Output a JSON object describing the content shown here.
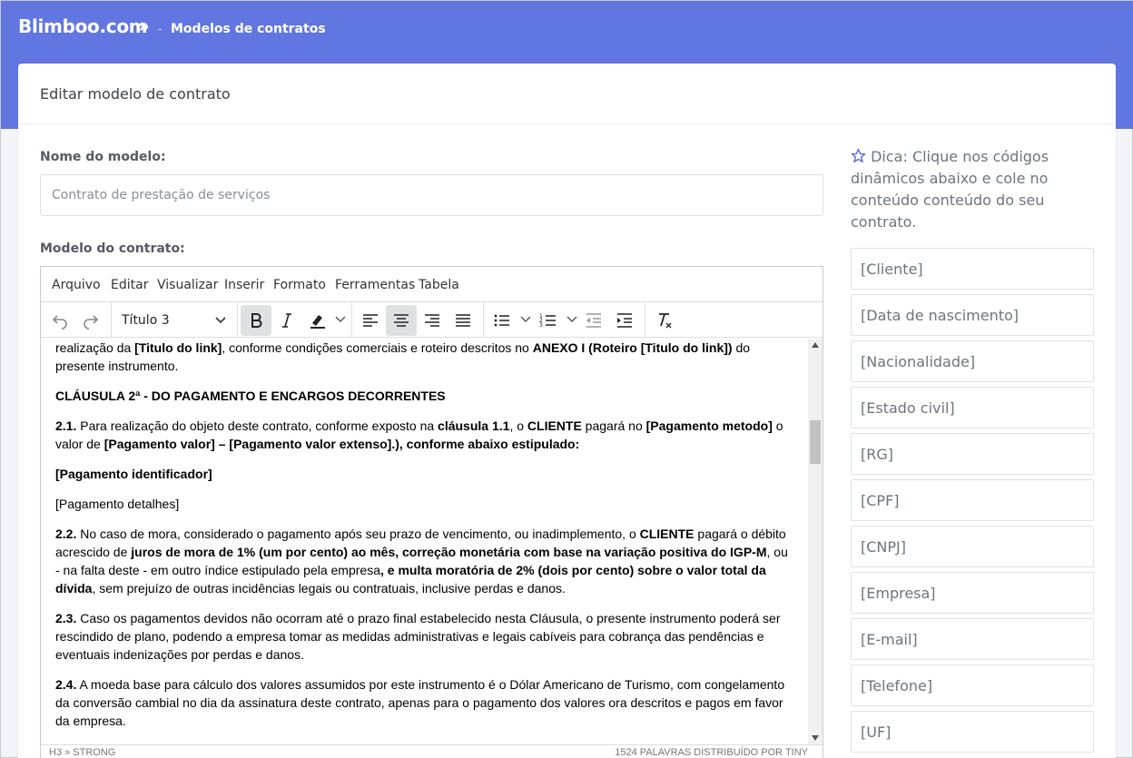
{
  "header": {
    "brand": "Blimboo.com",
    "brand_separator": "»",
    "crumb_dash": "-",
    "crumb": "Modelos de contratos"
  },
  "card": {
    "title": "Editar modelo de contrato"
  },
  "form": {
    "name_label": "Nome do modelo:",
    "name_value": "Contrato de prestação de serviços",
    "model_label": "Modelo do contrato:"
  },
  "editor": {
    "menu": [
      "Arquivo",
      "Editar",
      "Visualizar",
      "Inserir",
      "Formato",
      "Ferramentas",
      "Tabela"
    ],
    "block_format": "Título 3",
    "status_path": "H3 » STRONG",
    "status_count": "1524 PALAVRAS DISTRIBUÍDO POR TINY",
    "content": {
      "p0_a": "realização da ",
      "p0_b": "[Titulo do link]",
      "p0_c": ", conforme condições comerciais e roteiro descritos no ",
      "p0_d": "ANEXO I (Roteiro [Titulo do link])",
      "p0_e": " do presente instrumento.",
      "clause2": "CLÁUSULA 2ª - DO PAGAMENTO E ENCARGOS DECORRENTES",
      "p21_num": "2.1.",
      "p21_a": " Para realização do objeto deste contrato, conforme exposto na ",
      "p21_b": "cláusula 1.1",
      "p21_c": ", o ",
      "p21_d": "CLIENTE",
      "p21_e": " pagará no ",
      "p21_f": "[Pagamento metodo]",
      "p21_g": " o valor de ",
      "p21_h": "[Pagamento valor] – [Pagamento valor extenso].), conforme abaixo estipulado:",
      "pay_id": "[Pagamento identificador]",
      "pay_details": "[Pagamento detalhes]",
      "p22_num": "2.2.",
      "p22_a": " No caso de mora, considerado o pagamento após seu prazo de vencimento, ou inadimplemento, o ",
      "p22_b": "CLIENTE",
      "p22_c": " pagará o débito acrescido de ",
      "p22_d": "juros de mora de 1% (um por cento) ao mês, correção monetária com base na variação positiva do IGP-M",
      "p22_e": ", ou - na falta deste - em outro índice estipulado pela empresa",
      "p22_f": ", e multa moratória de 2% (dois por cento) sobre o valor total da dívida",
      "p22_g": ", sem prejuízo de outras incidências legais ou contratuais, inclusive perdas e danos.",
      "p23_num": "2.3.",
      "p23_a": " Caso os pagamentos devidos não ocorram até o prazo final estabelecido nesta Cláusula, o presente instrumento poderá ser rescindido de plano, podendo a empresa tomar as medidas administrativas e legais cabíveis para cobrança das pendências e eventuais indenizações por perdas e danos.",
      "p24_num": "2.4.",
      "p24_a": " A moeda base para cálculo dos valores assumidos por este instrumento é o Dólar Americano de Turismo, com congelamento da conversão cambial no dia da assinatura deste contrato, apenas para o pagamento dos valores ora descritos e pagos em favor da empresa."
    }
  },
  "sidebar": {
    "tip": "Dica: Clique nos códigos dinâmicos abaixo e cole no conteúdo conteúdo do seu contrato.",
    "codes": [
      "[Cliente]",
      "[Data de nascimento]",
      "[Nacionalidade]",
      "[Estado civil]",
      "[RG]",
      "[CPF]",
      "[CNPJ]",
      "[Empresa]",
      "[E-mail]",
      "[Telefone]",
      "[UF]"
    ]
  },
  "colors": {
    "header_bg": "#6176e0",
    "accent": "#5b6fdc"
  }
}
